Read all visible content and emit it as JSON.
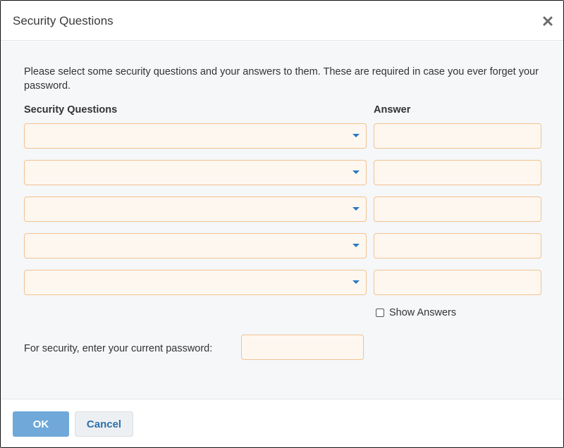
{
  "dialog": {
    "title": "Security Questions",
    "close_icon": "close-icon"
  },
  "intro_text": "Please select some security questions and your answers to them. These are required in case you ever forget your password.",
  "columns": {
    "questions_label": "Security Questions",
    "answer_label": "Answer"
  },
  "rows": [
    {
      "question": "",
      "answer": ""
    },
    {
      "question": "",
      "answer": ""
    },
    {
      "question": "",
      "answer": ""
    },
    {
      "question": "",
      "answer": ""
    },
    {
      "question": "",
      "answer": ""
    }
  ],
  "show_answers": {
    "label": "Show Answers",
    "checked": false
  },
  "password": {
    "label": "For security, enter your current password:",
    "value": ""
  },
  "footer": {
    "ok_label": "OK",
    "cancel_label": "Cancel"
  },
  "colors": {
    "field_border": "#f3c28f",
    "field_bg": "#fdf7f0",
    "accent": "#2a7ac0",
    "ok_button": "#6fa8d9"
  }
}
